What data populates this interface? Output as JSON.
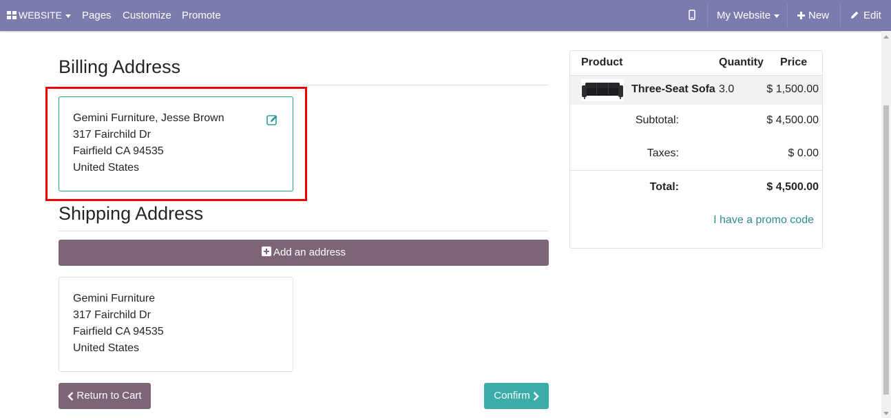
{
  "navbar": {
    "website_label": "WEBSITE",
    "pages": "Pages",
    "customize": "Customize",
    "promote": "Promote",
    "my_website": "My Website",
    "new": "New",
    "edit": "Edit"
  },
  "billing": {
    "title": "Billing Address",
    "lines": [
      "Gemini Furniture, Jesse Brown",
      "317 Fairchild Dr",
      "Fairfield CA 94535",
      "United States"
    ]
  },
  "shipping": {
    "title": "Shipping Address",
    "add_label": "Add an address",
    "lines": [
      "Gemini Furniture",
      "317 Fairchild Dr",
      "Fairfield CA 94535",
      "United States"
    ]
  },
  "actions": {
    "return_label": "Return to Cart",
    "confirm_label": "Confirm"
  },
  "summary": {
    "headers": {
      "product": "Product",
      "quantity": "Quantity",
      "price": "Price"
    },
    "items": [
      {
        "name": "Three-Seat Sofa",
        "quantity": "3.0",
        "price": "$ 1,500.00"
      }
    ],
    "subtotal_label": "Subtotal:",
    "subtotal_value": "$ 4,500.00",
    "taxes_label": "Taxes:",
    "taxes_value": "$ 0.00",
    "total_label": "Total:",
    "total_value": "$ 4,500.00",
    "promo_label": "I have a promo code"
  },
  "colors": {
    "navbar": "#7c7bad",
    "primary_button": "#7d6476",
    "confirm_button": "#3aadaa",
    "highlight": "#ee0000",
    "selected_border": "#2c9aa1",
    "link": "#2c8c8a"
  }
}
